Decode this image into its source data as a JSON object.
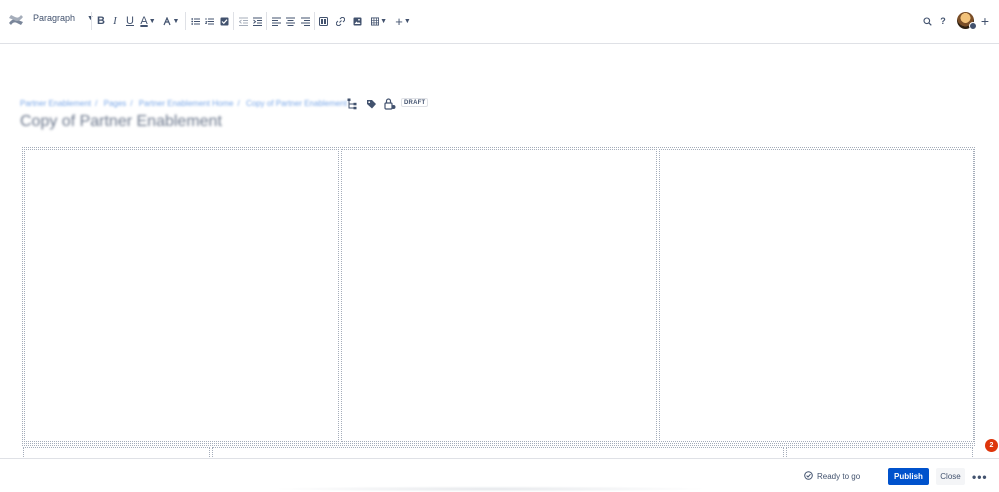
{
  "toolbar": {
    "logo_icon": "confluence-logo-icon",
    "text_style": "Paragraph",
    "formatting": [
      "bold-icon",
      "italic-icon",
      "underline-icon",
      "text-color-icon",
      "clear-format-icon"
    ],
    "lists": [
      "bullet-list-icon",
      "numbered-list-icon",
      "task-list-icon",
      "outdent-icon",
      "indent-icon"
    ],
    "alignment": [
      "align-left-icon",
      "align-center-icon",
      "align-right-icon"
    ],
    "insert": [
      "layout-icon",
      "link-icon",
      "image-icon",
      "table-icon",
      "insert-plus-icon"
    ],
    "right": [
      "search-icon",
      "help-icon",
      "avatar",
      "add-icon"
    ]
  },
  "page": {
    "breadcrumb": [
      "Partner Enablement",
      "Pages",
      "Partner Enablement Home",
      "Copy of Partner Enablement"
    ],
    "breadcrumb_sep": "/",
    "status": "DRAFT",
    "title": "Copy of Partner Enablement"
  },
  "footer": {
    "ready_text": "Ready to go",
    "publish_label": "Publish",
    "close_label": "Close",
    "more_label": "•••"
  },
  "notification": {
    "count": "2"
  },
  "colors": {
    "primary": "#0052cc",
    "danger": "#de350b",
    "text": "#42526e"
  }
}
